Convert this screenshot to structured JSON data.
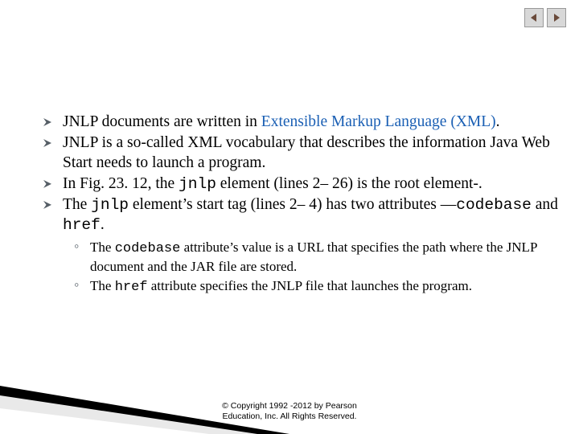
{
  "nav": {
    "prev_label": "previous-slide",
    "next_label": "next-slide"
  },
  "bullets": {
    "b1_pre": "JNLP documents are written in ",
    "b1_link": "Extensible Markup Language (XML)",
    "b1_post": ".",
    "b2": "JNLP is a so-called XML vocabulary that describes the information Java Web Start needs to launch a program.",
    "b3_a": "In Fig. 23. 12, the ",
    "b3_code": "jnlp",
    "b3_b": " element (lines 2– 26) is the root element-.",
    "b4_a": "The ",
    "b4_code1": "jnlp",
    "b4_b": " element’s start tag (lines 2– 4) has two attributes —",
    "b4_code2": "codebase",
    "b4_c": " and ",
    "b4_code3": "href",
    "b4_d": "."
  },
  "sub": {
    "s1_a": "The ",
    "s1_code": "codebase",
    "s1_b": " attribute’s value is a URL that specifies the path where the JNLP document and the JAR file are stored.",
    "s2_a": "The ",
    "s2_code": "href",
    "s2_b": " attribute specifies the JNLP file that launches the program."
  },
  "footer": {
    "line1": "© Copyright 1992 -2012 by Pearson",
    "line2": "Education, Inc. All Rights Reserved."
  }
}
